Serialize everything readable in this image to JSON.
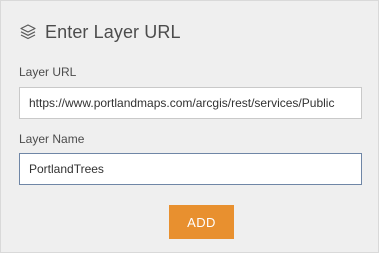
{
  "dialog": {
    "title": "Enter Layer URL",
    "title_icon": "layers-icon"
  },
  "layer_url": {
    "label": "Layer URL",
    "value": "https://www.portlandmaps.com/arcgis/rest/services/Public"
  },
  "layer_name": {
    "label": "Layer Name",
    "value": "PortlandTrees"
  },
  "actions": {
    "add_label": "ADD"
  },
  "colors": {
    "panel_background": "#efefef",
    "add_button": "#e8902f",
    "focused_border": "#6f86a6"
  }
}
